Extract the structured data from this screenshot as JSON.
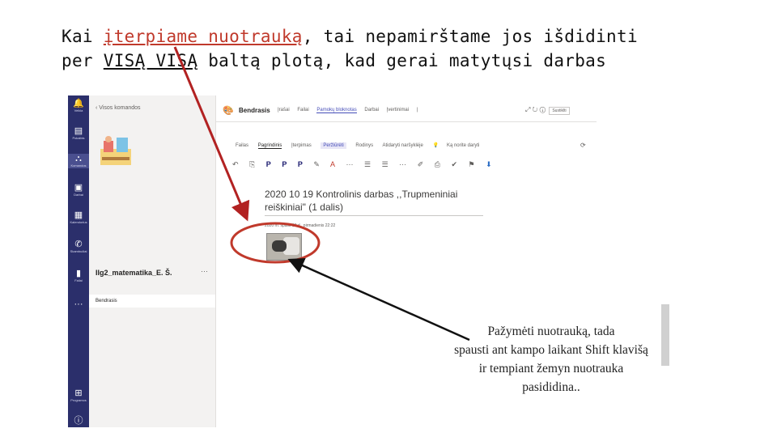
{
  "heading": {
    "p1": "Kai ",
    "p2": "įterpiame nuotrauką",
    "p3": ", tai nepamirštame jos išdidinti",
    "p4": "per ",
    "p5": "VISĄ VISĄ",
    "p6": " baltą plotą, kad gerai matytųsi darbas"
  },
  "rail": [
    {
      "icon": "bell-icon",
      "label": "Veikla"
    },
    {
      "icon": "chat-icon",
      "label": "Pokalbis"
    },
    {
      "icon": "teams-icon",
      "label": "Komandos"
    },
    {
      "icon": "assignments-icon",
      "label": "Darbai"
    },
    {
      "icon": "calendar-icon",
      "label": "Kalendorius"
    },
    {
      "icon": "calls-icon",
      "label": "Skambučiai"
    },
    {
      "icon": "files-icon",
      "label": "Failai"
    },
    {
      "icon": "more-icon",
      "label": ""
    },
    {
      "icon": "apps-icon",
      "label": "Programos"
    },
    {
      "icon": "help-icon",
      "label": ""
    }
  ],
  "panel": {
    "back_label": "Visos komandos",
    "team_name": "IIg2_matematika_E. Š.",
    "more": "···",
    "channel": "Bendrasis"
  },
  "app": {
    "name": "Bendrasis",
    "tabs": [
      "Įrašai",
      "Failai",
      "Pamokų bloknotas",
      "Darbai",
      "Įvertinimai"
    ],
    "selected_tab": "Pamokų bloknotas",
    "right_icons": [
      "⤢",
      "↻",
      "ⓘ"
    ],
    "end_button": "Sustiklti"
  },
  "ribbon": {
    "tabs": [
      "Failas",
      "Pagrindinis",
      "Įterpimas",
      "Peržiūrėti",
      "Rodinys",
      "Atidaryti naršyklėje"
    ],
    "current_tab": "Pagrindinis",
    "highlight_tab": "Peržiūrėti",
    "tell_me": "Ką norite daryti",
    "tools": [
      "↶",
      "⎘",
      "P",
      "P",
      "P",
      "✎",
      "A",
      "···",
      "☰",
      "☰",
      "···",
      "✐",
      "⎙",
      "✔",
      "⚑",
      "⬇"
    ]
  },
  "page": {
    "title": "2020 10 19 Kontrolinis darbas ,,Trupmeniniai reiškiniai\" (1 dalis)",
    "date": "2020 m. spalio 19 d., pirmadienis    22:22"
  },
  "note": {
    "line1": "Pažymėti nuotrauką, tada",
    "line2": "spausti ant kampo laikant Shift klavišą",
    "line3": "ir tempiant žemyn nuotrauka",
    "line4": "pasididina.."
  }
}
